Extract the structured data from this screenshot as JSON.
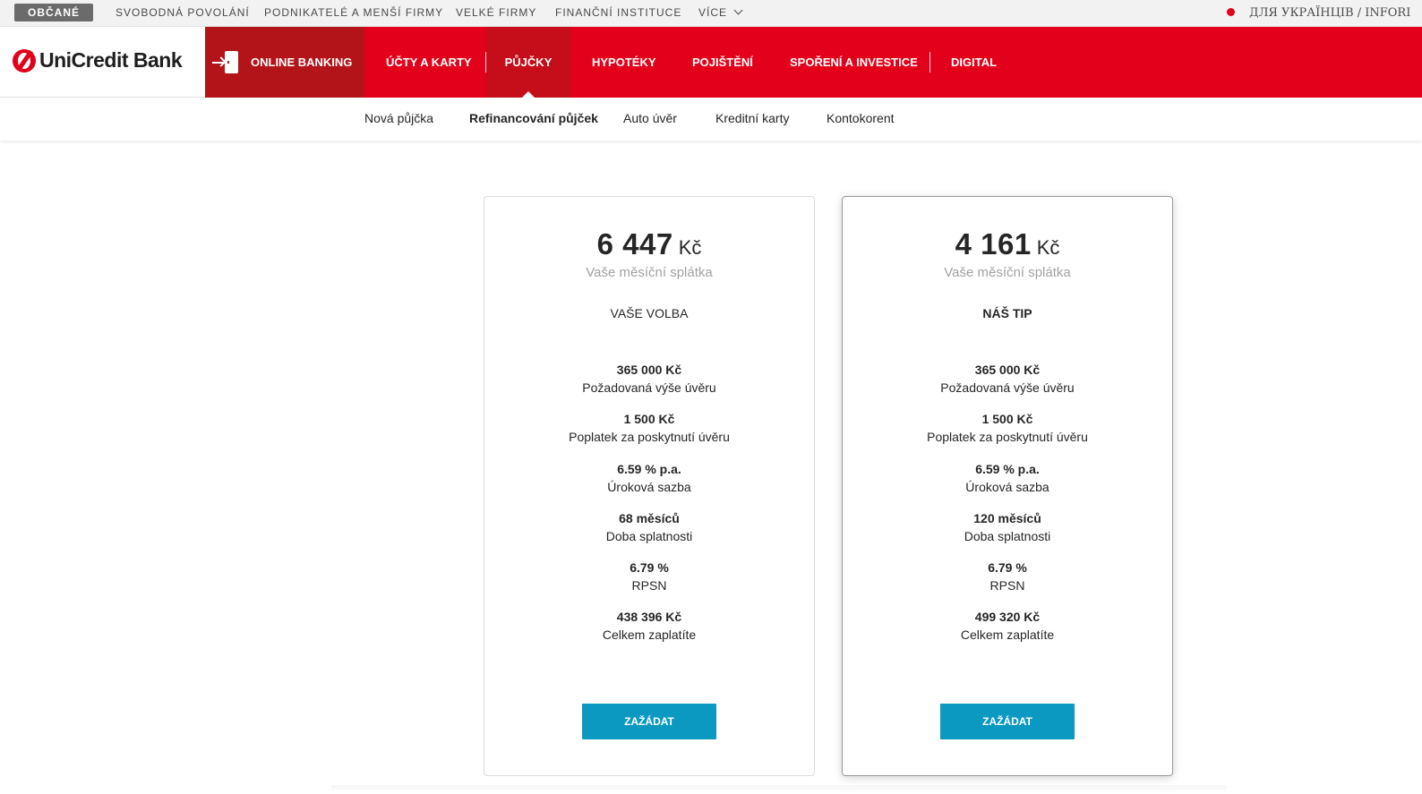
{
  "segments": {
    "active": "Občané",
    "items": [
      "Svobodná povolání",
      "Podnikatelé a menší firmy",
      "Velké firmy",
      "Finanční instituce"
    ],
    "more": "Více",
    "ukraine_link": "ДЛЯ УКРАЇНЦІВ / INFORI"
  },
  "header": {
    "logo_text": "UniCredit Bank",
    "online_banking": "Online Banking",
    "nav": [
      "ÚČTY A KARTY",
      "PŮJČKY",
      "HYPOTÉKY",
      "POJIŠTĚNÍ",
      "SPOŘENÍ A INVESTICE",
      "DIGITAL"
    ],
    "active_nav": "PŮJČKY"
  },
  "subnav": {
    "items": [
      "Nová půjčka",
      "Refinancování půjček",
      "Auto úvěr",
      "Kreditní karty",
      "Kontokorent"
    ],
    "active": "Refinancování půjček"
  },
  "cards": [
    {
      "payment_amount": "6 447",
      "currency": "Kč",
      "payment_label": "Vaše měsíční splátka",
      "variant": "VAŠE VOLBA",
      "params": [
        {
          "value": "365 000 Kč",
          "label": "Požadovaná výše úvěru"
        },
        {
          "value": "1 500 Kč",
          "label": "Poplatek za poskytnutí úvěru"
        },
        {
          "value": "6.59 % p.a.",
          "label": "Úroková sazba"
        },
        {
          "value": "68 měsíců",
          "label": "Doba splatnosti"
        },
        {
          "value": "6.79 %",
          "label": "RPSN"
        },
        {
          "value": "438 396 Kč",
          "label": "Celkem zaplatíte"
        }
      ],
      "button": "ZAŽÁDAT"
    },
    {
      "payment_amount": "4 161",
      "currency": "Kč",
      "payment_label": "Vaše měsíční splátka",
      "variant": "NÁŠ TIP",
      "params": [
        {
          "value": "365 000 Kč",
          "label": "Požadovaná výše úvěru"
        },
        {
          "value": "1 500 Kč",
          "label": "Poplatek za poskytnutí úvěru"
        },
        {
          "value": "6.59 % p.a.",
          "label": "Úroková sazba"
        },
        {
          "value": "120 měsíců",
          "label": "Doba splatnosti"
        },
        {
          "value": "6.79 %",
          "label": "RPSN"
        },
        {
          "value": "499 320 Kč",
          "label": "Celkem zaplatíte"
        }
      ],
      "button": "ZAŽÁDAT"
    }
  ],
  "colors": {
    "brand_red": "#e2001a",
    "online_banking_bg": "#b3141a",
    "cta_blue": "#0b99c2"
  }
}
